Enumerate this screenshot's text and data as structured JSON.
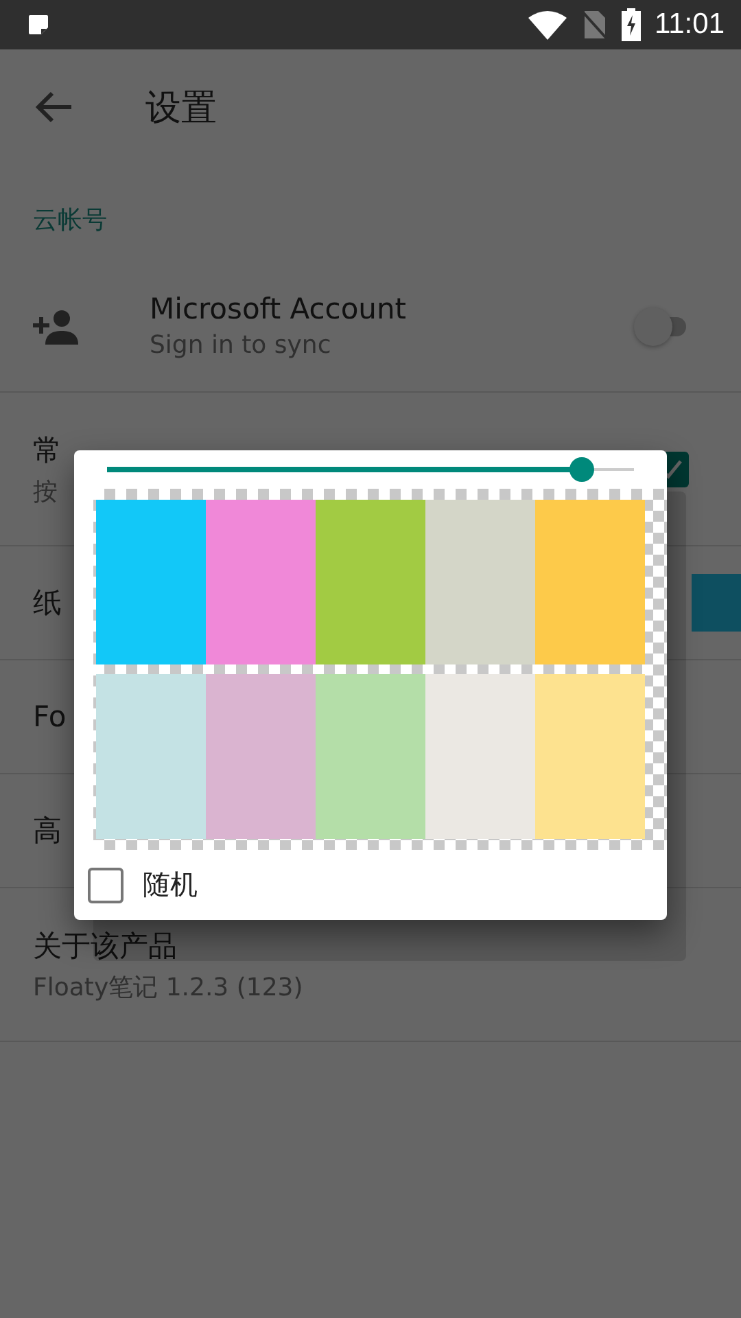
{
  "status_bar": {
    "time": "11:01"
  },
  "toolbar": {
    "title": "设置"
  },
  "section_header": "云帐号",
  "settings": [
    {
      "kind": "switch",
      "title": "Microsoft Account",
      "subtitle": "Sign in to sync",
      "on": false
    },
    {
      "kind": "checkbox",
      "title": "常",
      "subtitle": "按",
      "checked": true
    },
    {
      "kind": "swatch",
      "title": "纸",
      "color": "#0e4f60"
    },
    {
      "kind": "plain",
      "title": "Fo"
    },
    {
      "kind": "plain",
      "title": "高"
    },
    {
      "kind": "plain",
      "title": "关于该产品",
      "subtitle": "Floaty笔记 1.2.3 (123)"
    }
  ],
  "dialog": {
    "level": 0.9,
    "swatches": [
      {
        "color": "#12c8f8"
      },
      {
        "color": "#f088d8"
      },
      {
        "color": "#a2cb43"
      },
      {
        "color": "#d4d6c8"
      },
      {
        "color": "#fdca4a"
      },
      {
        "color": "#c4e2e4"
      },
      {
        "color": "#dab4d0"
      },
      {
        "color": "#b4dea8"
      },
      {
        "color": "#ebe8e3"
      },
      {
        "color": "#fde28f"
      }
    ],
    "random": {
      "label": "随机",
      "checked": false
    }
  }
}
